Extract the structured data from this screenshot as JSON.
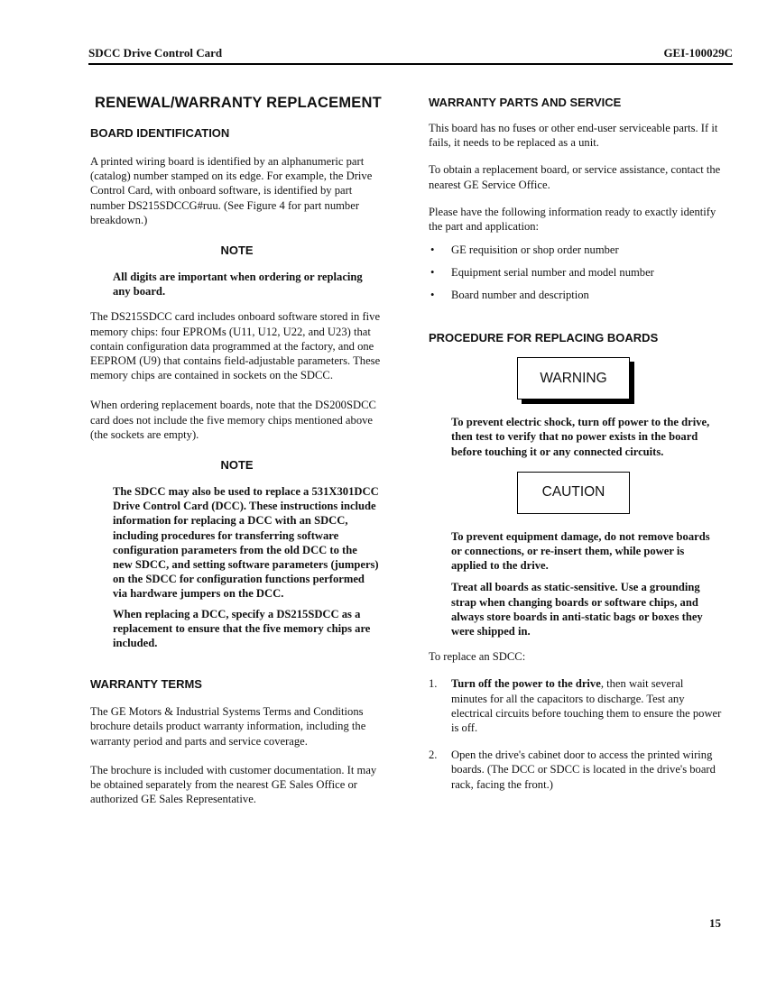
{
  "header": {
    "title": "SDCC Drive Control Card",
    "doc_number": "GEI-100029C"
  },
  "left_column": {
    "main_heading": "RENEWAL/WARRANTY REPLACEMENT",
    "board_identification": {
      "heading": "BOARD IDENTIFICATION",
      "paragraph": "A printed wiring board is identified by an alphanumeric part (catalog) number stamped on its edge. For example, the Drive Control Card, with onboard software, is identified by part number DS215SDCCG#ruu. (See Figure 4 for part number breakdown.)"
    },
    "note1": {
      "title": "NOTE",
      "text": "All digits are important when ordering or replacing any board."
    },
    "paragraph_software": "The DS215SDCC card includes onboard software stored in five memory chips: four EPROMs (U11, U12, U22, and U23) that contain configuration data programmed at the factory, and one EEPROM (U9) that contains field-adjustable parameters. These memory chips are contained in sockets on the SDCC.",
    "paragraph_ordering": "When ordering replacement boards, note that the DS200SDCC card does not include the five memory chips mentioned above (the sockets are empty).",
    "note2": {
      "title": "NOTE",
      "text1": "The SDCC may also be used to replace a 531X301DCC Drive Control Card (DCC). These instructions include information for replacing a DCC with an SDCC, including procedures for transferring software configuration parameters from the old DCC to the new SDCC, and setting software parameters (jumpers) on the SDCC for configuration functions performed via hardware jumpers on the DCC.",
      "text2": "When replacing a DCC, specify a DS215SDCC as a replacement to ensure that the five memory chips are included."
    },
    "warranty_terms": {
      "heading": "WARRANTY TERMS",
      "paragraph1": "The GE Motors & Industrial Systems Terms and Conditions brochure details product warranty information, including the warranty period and parts and service coverage.",
      "paragraph2": "The brochure is included with customer documentation. It may be obtained separately from the nearest GE Sales Office or authorized GE Sales Representative."
    }
  },
  "right_column": {
    "warranty_parts": {
      "heading": "WARRANTY PARTS AND SERVICE",
      "paragraph1": "This board has no fuses or other end-user serviceable parts. If it fails, it needs to be replaced as a unit.",
      "paragraph2": "To obtain a replacement board, or service assistance, contact the nearest GE Service Office.",
      "paragraph3": "Please have the following information ready to exactly identify the part and application:",
      "bullet_glyph": "•",
      "bullets": [
        "GE requisition or shop order number",
        "Equipment serial number and model number",
        "Board number and description"
      ]
    },
    "procedure": {
      "heading": "PROCEDURE FOR REPLACING BOARDS",
      "warning_label": "WARNING",
      "warning_text": "To prevent electric shock, turn off power to the drive, then test to verify that no power exists in the board before touching it or any connected circuits.",
      "caution_label": "CAUTION",
      "caution_text1": "To prevent equipment damage, do not remove boards or connections, or re-insert them, while power is applied to the drive.",
      "caution_text2": "Treat all boards as static-sensitive. Use a grounding strap when changing boards or software chips, and always store boards in anti-static bags or boxes they were shipped in.",
      "intro": "To replace an SDCC:",
      "steps": [
        {
          "number": "1.",
          "bold": "Turn off the power to the drive",
          "rest": ", then wait several minutes for all the capacitors to discharge. Test any electrical circuits before touching them to ensure the power is off."
        },
        {
          "number": "2.",
          "bold": "",
          "rest": "Open the drive's cabinet door to access the printed wiring boards. (The DCC or SDCC is located in the drive's board rack, facing the front.)"
        }
      ]
    }
  },
  "footer": {
    "page_number": "15"
  }
}
